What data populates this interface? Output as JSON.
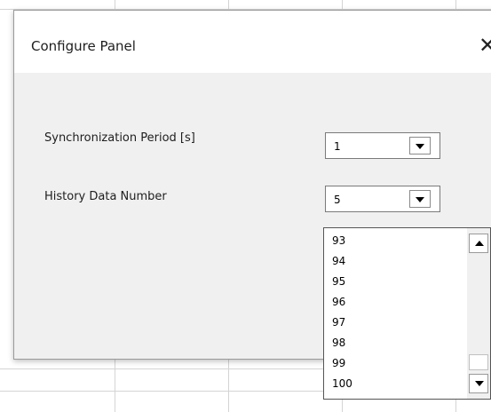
{
  "dialog": {
    "title": "Configure Panel",
    "close_glyph": "✕"
  },
  "fields": {
    "sync_period": {
      "label": "Synchronization Period [s]",
      "value": "1"
    },
    "history_number": {
      "label": "History Data Number",
      "value": "5"
    }
  },
  "dropdown": {
    "options": [
      "93",
      "94",
      "95",
      "96",
      "97",
      "98",
      "99",
      "100"
    ]
  },
  "icons": {
    "dropdown_arrow": "chevron-down-icon",
    "scroll_up": "scroll-up-icon",
    "scroll_down": "scroll-down-icon",
    "close": "close-icon"
  },
  "colors": {
    "dialog_bg": "#f0f0f0",
    "titlebar_bg": "#ffffff",
    "grid": "#d4d4d4"
  }
}
